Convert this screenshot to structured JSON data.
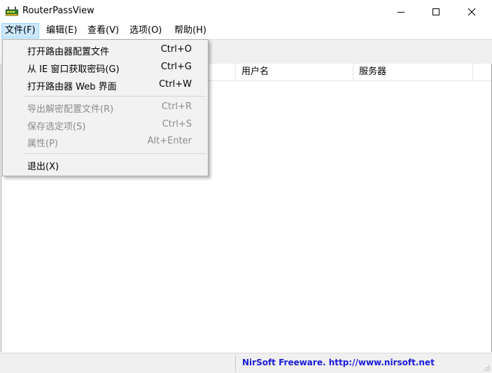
{
  "window": {
    "title": "RouterPassView",
    "icon": "router-app-icon",
    "controls": [
      "minimize-icon",
      "maximize-icon",
      "close-icon"
    ]
  },
  "menubar": {
    "items": [
      {
        "label": "文件(F)",
        "active": true
      },
      {
        "label": "编辑(E)"
      },
      {
        "label": "查看(V)"
      },
      {
        "label": "选项(O)"
      },
      {
        "label": "帮助(H)"
      }
    ]
  },
  "file_menu": {
    "items": [
      {
        "label": "打开路由器配置文件",
        "shortcut": "Ctrl+O",
        "enabled": true
      },
      {
        "label": "从 IE 窗口获取密码(G)",
        "shortcut": "Ctrl+G",
        "enabled": true
      },
      {
        "label": "打开路由器 Web 界面",
        "shortcut": "Ctrl+W",
        "enabled": true
      },
      {
        "label": "导出解密配置文件(R)",
        "shortcut": "Ctrl+R",
        "enabled": false
      },
      {
        "label": "保存选定项(S)",
        "shortcut": "Ctrl+S",
        "enabled": false
      },
      {
        "label": "属性(P)",
        "shortcut": "Alt+Enter",
        "enabled": false
      },
      {
        "label": "退出(X)",
        "shortcut": "",
        "enabled": true
      }
    ]
  },
  "list": {
    "columns": [
      "",
      "用户名",
      "服务器"
    ]
  },
  "statusbar": {
    "left": "",
    "link": "NirSoft Freeware.  http://www.nirsoft.net"
  }
}
